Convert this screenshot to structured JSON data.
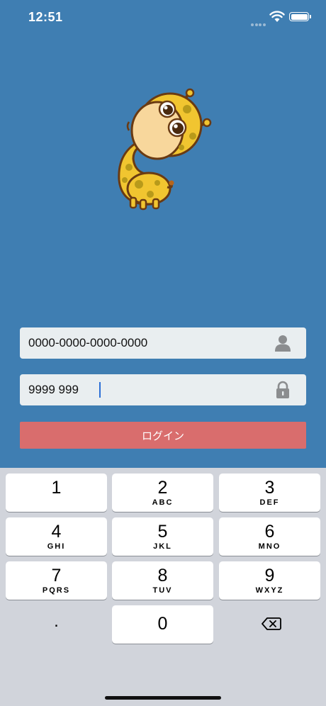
{
  "status_bar": {
    "time": "12:51"
  },
  "login_form": {
    "account_value": "0000-0000-0000-0000",
    "password_value": "9999 999",
    "login_label": "ログイン"
  },
  "keypad": {
    "keys": [
      {
        "num": "1",
        "letters": ""
      },
      {
        "num": "2",
        "letters": "ABC"
      },
      {
        "num": "3",
        "letters": "DEF"
      },
      {
        "num": "4",
        "letters": "GHI"
      },
      {
        "num": "5",
        "letters": "JKL"
      },
      {
        "num": "6",
        "letters": "MNO"
      },
      {
        "num": "7",
        "letters": "PQRS"
      },
      {
        "num": "8",
        "letters": "TUV"
      },
      {
        "num": "9",
        "letters": "WXYZ"
      }
    ],
    "dot": ".",
    "zero": "0"
  },
  "icons": {
    "account": "person-icon",
    "password": "lock-icon",
    "delete": "delete-backspace-icon"
  },
  "colors": {
    "background": "#3f7eb2",
    "login_button": "#d96d6d",
    "field": "#e9eef0",
    "keyboard": "#d1d4db"
  }
}
